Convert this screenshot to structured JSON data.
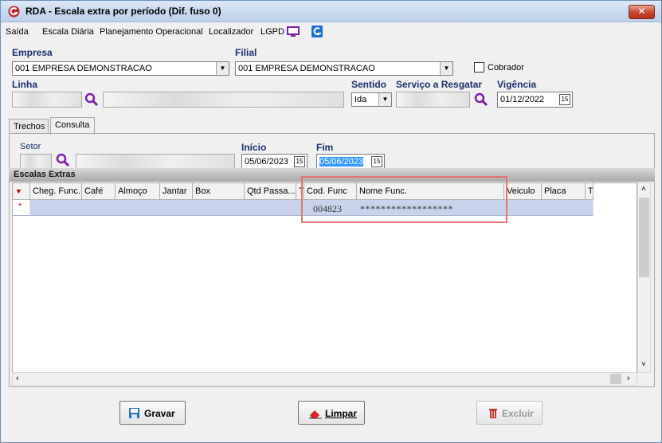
{
  "window": {
    "title": "RDA - Escala extra por período (Dif. fuso 0)",
    "close_label": "✕"
  },
  "menu": {
    "items": [
      "Saída",
      "Escala Diária",
      "Planejamento Operacional",
      "Localizador",
      "LGPD"
    ]
  },
  "form": {
    "empresa_label": "Empresa",
    "empresa_value": "001 EMPRESA DEMONSTRACAO",
    "filial_label": "Filial",
    "filial_value": "001 EMPRESA DEMONSTRACAO",
    "cobrador_label": "Cobrador",
    "linha_label": "Linha",
    "sentido_label": "Sentido",
    "sentido_value": "Ida",
    "servico_label": "Serviço a Resgatar",
    "vigencia_label": "Vigência",
    "vigencia_value": "01/12/2022"
  },
  "tabs": [
    "Trechos",
    "Consulta"
  ],
  "consulta": {
    "setor_label": "Setor",
    "inicio_label": "Início",
    "inicio_value": "05/06/2023",
    "fim_label": "Fim",
    "fim_value": "05/06/2023"
  },
  "grid": {
    "section_title": "Escalas Extras",
    "columns": [
      "Cheg. Func.",
      "Café",
      "Almoço",
      "Jantar",
      "Box",
      "Qtd Passa...",
      "T",
      "Cod. Func",
      "Nome Func.",
      "Veiculo",
      "Placa",
      "T"
    ],
    "row_marker": "*",
    "row": {
      "cod_func": "004823",
      "nome_func": "******************"
    }
  },
  "buttons": {
    "gravar": "Gravar",
    "limpar": "Limpar",
    "excluir": "Excluir"
  }
}
